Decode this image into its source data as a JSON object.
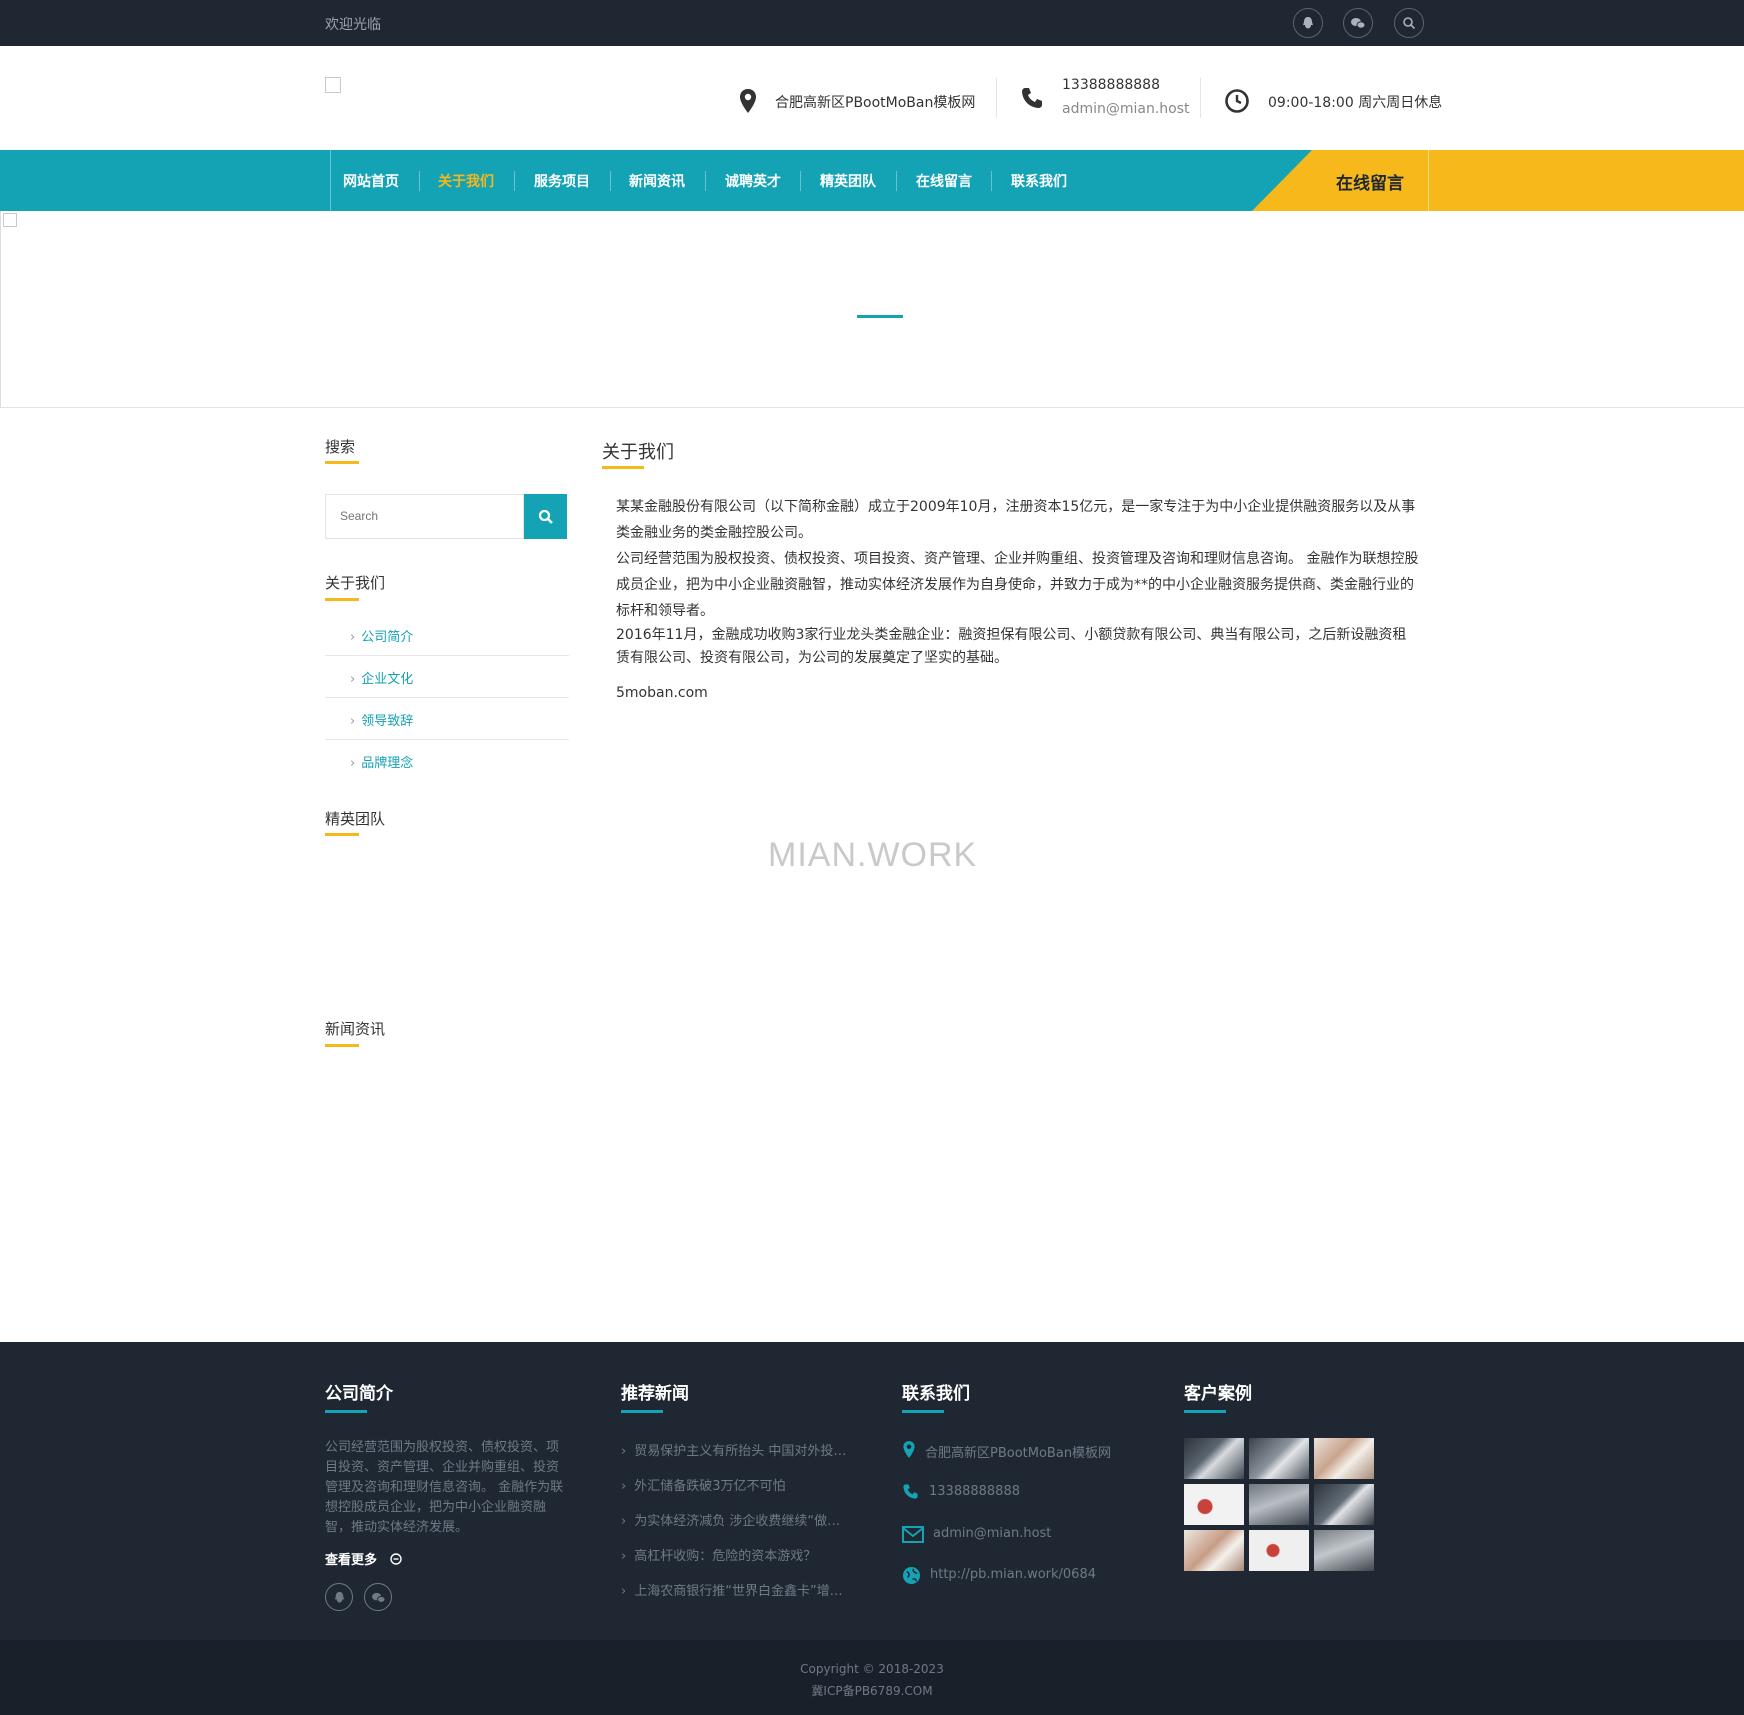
{
  "topbar": {
    "welcome": "欢迎光临",
    "icons": [
      "qq-icon",
      "wechat-icon",
      "search-icon"
    ]
  },
  "header": {
    "address": "合肥高新区PBootMoBan模板网",
    "phone": "13388888888",
    "email": "admin@mian.host",
    "hours": "09:00-18:00 周六周日休息"
  },
  "nav": {
    "items": [
      "网站首页",
      "关于我们",
      "服务项目",
      "新闻资讯",
      "诚聘英才",
      "精英团队",
      "在线留言",
      "联系我们"
    ],
    "active_index": 1,
    "cta": "在线留言"
  },
  "colors": {
    "accent": "#14a2b5",
    "highlight": "#f6b81a",
    "dark": "#1f2732"
  },
  "sidebar": {
    "search_title": "搜索",
    "search_placeholder": "Search",
    "about_title": "关于我们",
    "links": [
      "公司简介",
      "企业文化",
      "领导致辞",
      "品牌理念"
    ],
    "team_title": "精英团队",
    "news_title": "新闻资讯"
  },
  "main": {
    "title": "关于我们",
    "paragraphs": [
      "某某金融股份有限公司（以下简称金融）成立于2009年10月，注册资本15亿元，是一家专注于为中小企业提供融资服务以及从事类金融业务的类金融控股公司。",
      "公司经营范围为股权投资、债权投资、项目投资、资产管理、企业并购重组、投资管理及咨询和理财信息咨询。 金融作为联想控股成员企业，把为中小企业融资融智，推动实体经济发展作为自身使命，并致力于成为**的中小企业融资服务提供商、类金融行业的标杆和领导者。",
      " 2016年11月，金融成功收购3家行业龙头类金融企业：融资担保有限公司、小额贷款有限公司、典当有限公司，之后新设融资租赁有限公司、投资有限公司，为公司的发展奠定了坚实的基础。"
    ],
    "source": "5moban.com",
    "watermark": "MIAN.WORK"
  },
  "footer": {
    "about_title": "公司简介",
    "about_text": "公司经营范围为股权投资、债权投资、项目投资、资产管理、企业并购重组、投资管理及咨询和理财信息咨询。 金融作为联想控股成员企业，把为中小企业融资融智，推动实体经济发展。",
    "more": "查看更多",
    "news_title": "推荐新闻",
    "news": [
      "贸易保护主义有所抬头 中国对外投…",
      "外汇储备跌破3万亿不可怕",
      "为实体经济减负 涉企收费继续“做…",
      "高杠杆收购：危险的资本游戏？",
      "上海农商银行推“世界白金鑫卡”增…"
    ],
    "contact_title": "联系我们",
    "contact": {
      "address": "合肥高新区PBootMoBan模板网",
      "phone": "13388888888",
      "email": "admin@mian.host",
      "website": "http://pb.mian.work/0684"
    },
    "cases_title": "客户案例",
    "copyright": "Copyright © 2018-2023",
    "icp": "冀ICP备PB6789.COM"
  }
}
